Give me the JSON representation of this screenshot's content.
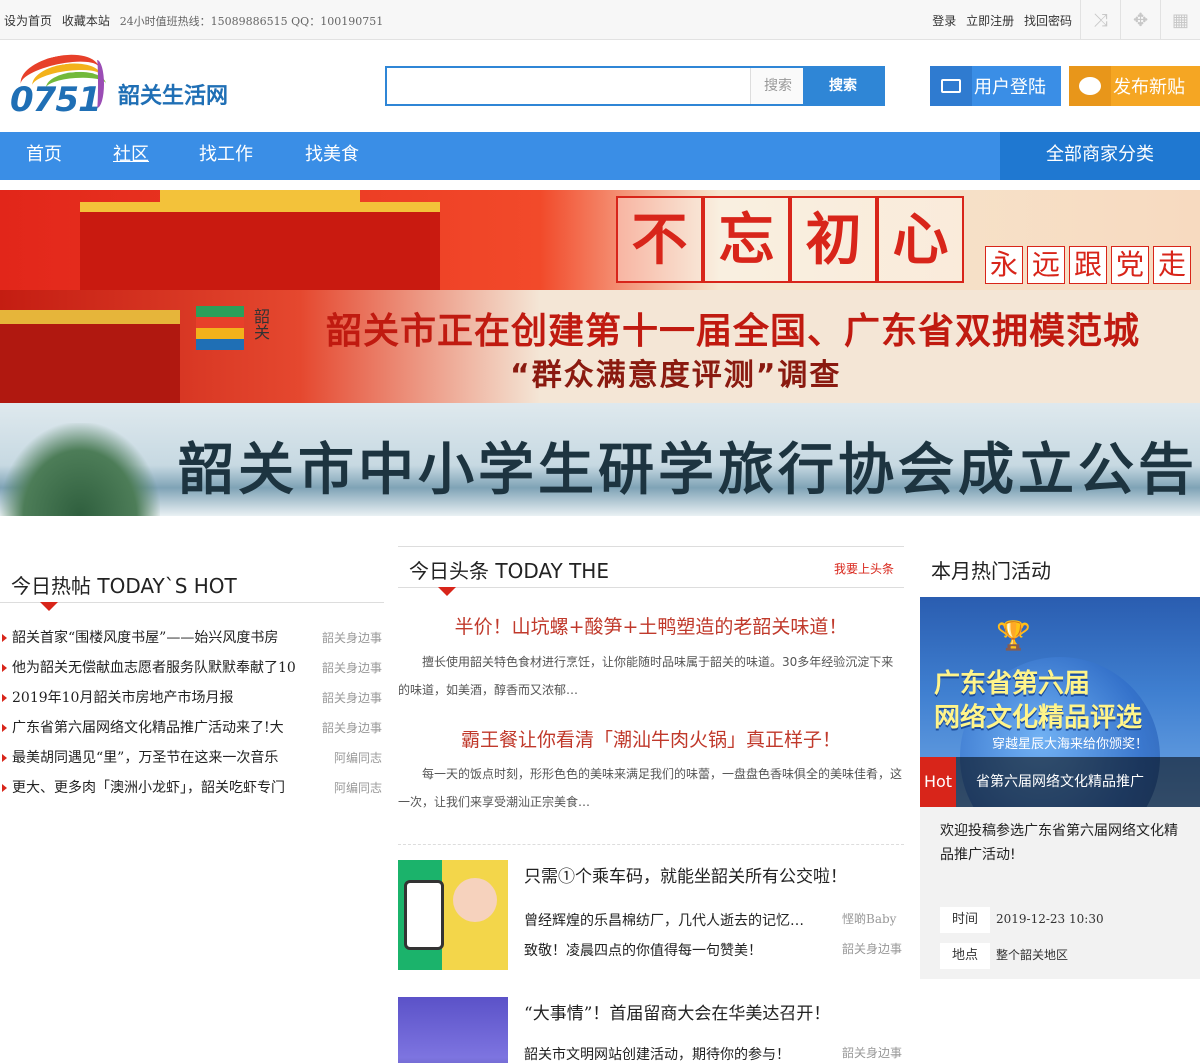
{
  "topbar": {
    "set_home": "设为首页",
    "bookmark": "收藏本站",
    "hotline": "24小时值班热线：15089886515 QQ：100190751",
    "login": "登录",
    "register": "立即注册",
    "forgot": "找回密码"
  },
  "header": {
    "logo_number": "0751",
    "logo_name": "韶关生活网",
    "search_placeholder": "",
    "search_hint": "搜索",
    "search_button": "搜索",
    "login_button": "用户登陆",
    "post_button": "发布新贴"
  },
  "nav": {
    "items": [
      "首页",
      "社区",
      "找工作",
      "找美食"
    ],
    "active_index": 1,
    "all_categories": "全部商家分类"
  },
  "banners": {
    "b1_chars": [
      "不",
      "忘",
      "初",
      "心"
    ],
    "b1_sub": [
      "永",
      "远",
      "跟",
      "党",
      "走"
    ],
    "b2_logo": "韶关",
    "b2_title": "韶关市正在创建第十一届全国、广东省双拥模范城",
    "b2_subtitle": "“群众满意度评测”调查",
    "b3_title": "韶关市中小学生研学旅行协会成立公告"
  },
  "hot": {
    "title": "今日热帖 TODAY`S HOT",
    "items": [
      {
        "title": "韶关首家“围楼风度书屋”——始兴风度书房",
        "source": "韶关身边事"
      },
      {
        "title": "他为韶关无偿献血志愿者服务队默默奉献了10",
        "source": "韶关身边事"
      },
      {
        "title": "2019年10月韶关市房地产市场月报",
        "source": "韶关身边事"
      },
      {
        "title": "广东省第六届网络文化精品推广活动来了!大",
        "source": "韶关身边事"
      },
      {
        "title": "最美胡同遇见“里”，万圣节在这来一次音乐",
        "source": "阿编同志"
      },
      {
        "title": "更大、更多肉「澳洲小龙虾」，韶关吃虾专门",
        "source": "阿编同志"
      }
    ]
  },
  "today": {
    "title": "今日头条 TODAY THE",
    "more": "我要上头条",
    "headlines": [
      {
        "title": "半价！山坑螺+酸笋+土鸭塑造的老韶关味道！",
        "desc": "擅长使用韶关特色食材进行烹饪，让你能随时品味属于韶关的味道。30多年经验沉淀下来的味道，如美酒，醇香而又浓郁…"
      },
      {
        "title": "霸王餐让你看清「潮汕牛肉火锅」真正样子！",
        "desc": "每一天的饭点时刻，形形色色的美味来满足我们的味蕾，一盘盘色香味俱全的美味佳肴，这一次，让我们来享受潮汕正宗美食…"
      }
    ],
    "news": [
      {
        "title": "只需①个乘车码，就能坐韶关所有公交啦！",
        "rows": [
          {
            "text": "曾经辉煌的乐昌棉纺厂，几代人逝去的记忆…",
            "source": "悭啲Baby"
          },
          {
            "text": "致敬！凌晨四点的你值得每一句赞美！",
            "source": "韶关身边事"
          }
        ]
      },
      {
        "title": "“大事情”！首届留商大会在华美达召开！",
        "rows": [
          {
            "text": "韶关市文明网站创建活动，期待你的参与！",
            "source": "韶关身边事"
          }
        ]
      }
    ]
  },
  "activity": {
    "title": "本月热门活动",
    "img_line1": "广东省第六届",
    "img_line2": "网络文化精品评选",
    "img_line3": "穿越星辰大海来给你颁奖！",
    "tag": "Hot",
    "caption": "省第六届网络文化精品推广",
    "desc": "欢迎投稿参选广东省第六届网络文化精品推广活动!",
    "time_label": "时间",
    "time_value": "2019-12-23 10:30",
    "place_label": "地点",
    "place_value": "整个韶关地区"
  }
}
